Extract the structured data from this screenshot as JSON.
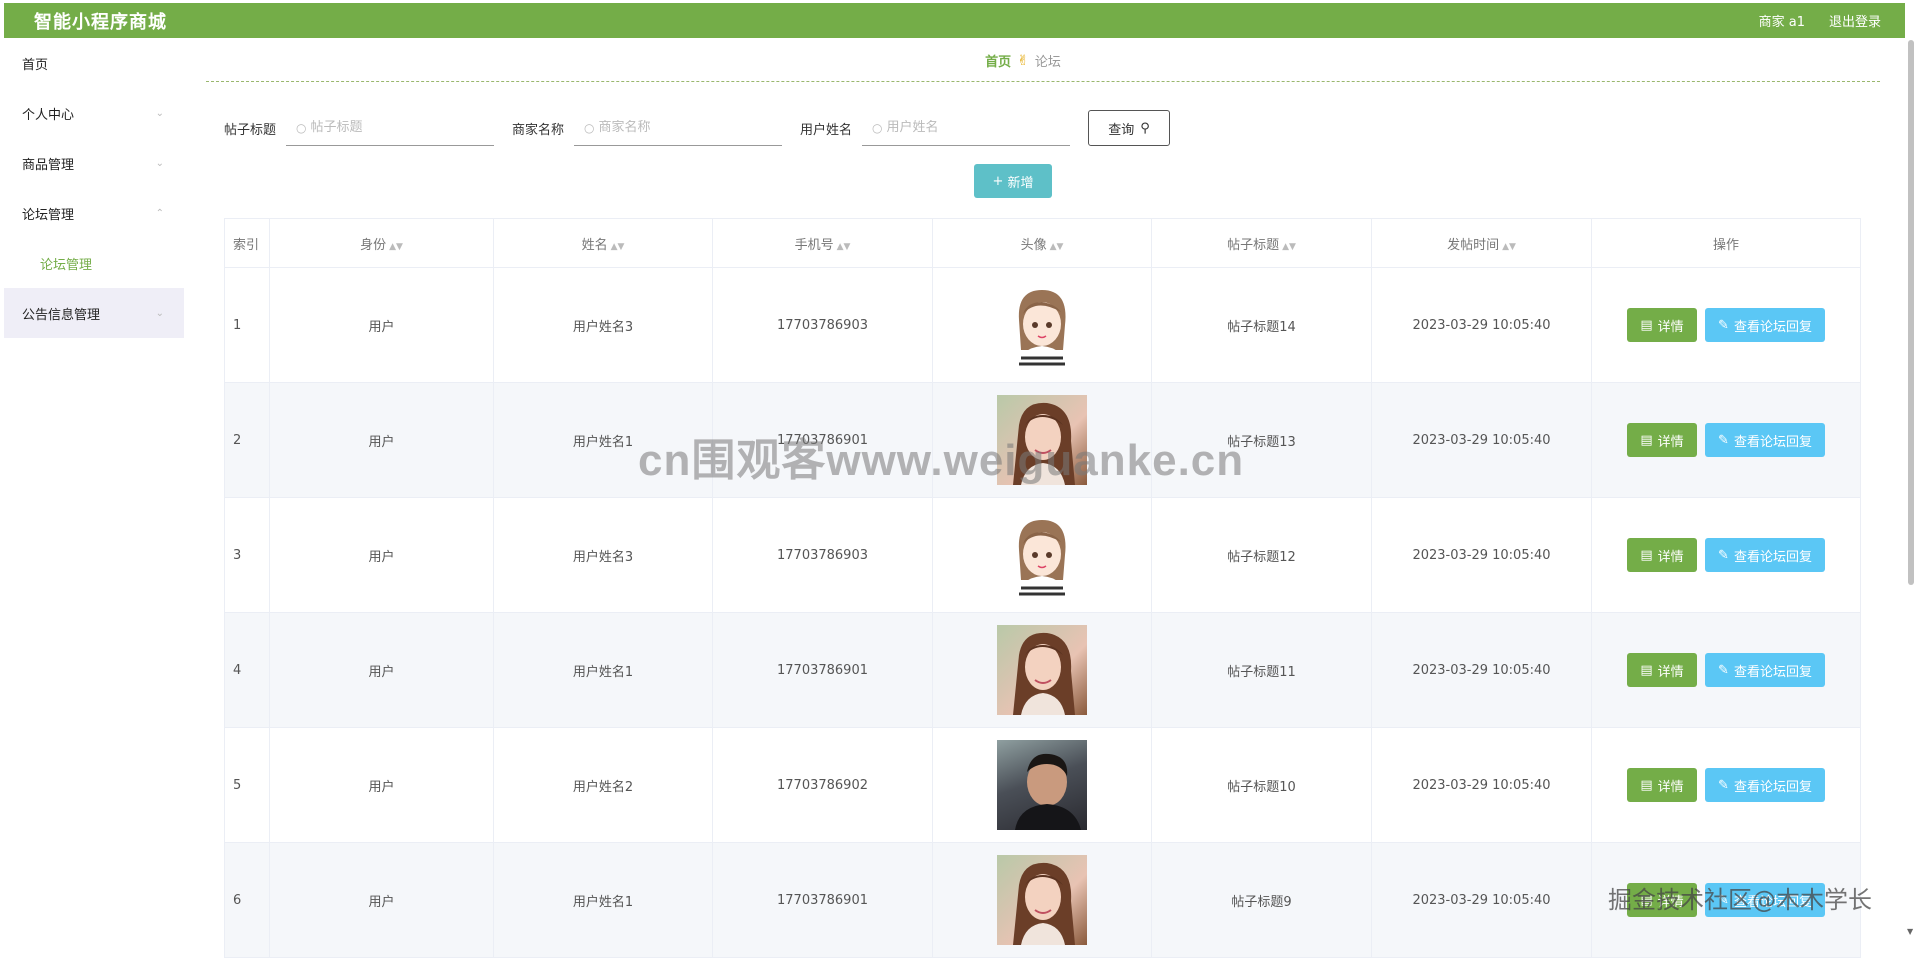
{
  "app": {
    "title": "智能小程序商城",
    "user_label": "商家 a1",
    "logout_label": "退出登录"
  },
  "sidebar": {
    "items": [
      {
        "label": "首页"
      },
      {
        "label": "个人中心"
      },
      {
        "label": "商品管理"
      },
      {
        "label": "论坛管理"
      },
      {
        "label": "论坛管理"
      },
      {
        "label": "公告信息管理"
      }
    ]
  },
  "breadcrumb": {
    "home": "首页",
    "current": "论坛"
  },
  "search": {
    "title_label": "帖子标题",
    "title_placeholder": "帖子标题",
    "merchant_label": "商家名称",
    "merchant_placeholder": "商家名称",
    "user_label": "用户姓名",
    "user_placeholder": "用户姓名",
    "query_label": "查询"
  },
  "add_label": "新增",
  "table": {
    "headers": [
      "索引",
      "身份",
      "姓名",
      "手机号",
      "头像",
      "帖子标题",
      "发帖时间",
      "操作"
    ],
    "detail_label": "详情",
    "reply_label": "查看论坛回复",
    "rows": [
      {
        "idx": "1",
        "role": "用户",
        "name": "用户姓名3",
        "phone": "17703786903",
        "avatar": "cartoon-girl",
        "title": "帖子标题14",
        "time": "2023-03-29 10:05:40"
      },
      {
        "idx": "2",
        "role": "用户",
        "name": "用户姓名1",
        "phone": "17703786901",
        "avatar": "photo-woman",
        "title": "帖子标题13",
        "time": "2023-03-29 10:05:40"
      },
      {
        "idx": "3",
        "role": "用户",
        "name": "用户姓名3",
        "phone": "17703786903",
        "avatar": "cartoon-girl",
        "title": "帖子标题12",
        "time": "2023-03-29 10:05:40"
      },
      {
        "idx": "4",
        "role": "用户",
        "name": "用户姓名1",
        "phone": "17703786901",
        "avatar": "photo-woman",
        "title": "帖子标题11",
        "time": "2023-03-29 10:05:40"
      },
      {
        "idx": "5",
        "role": "用户",
        "name": "用户姓名2",
        "phone": "17703786902",
        "avatar": "photo-man",
        "title": "帖子标题10",
        "time": "2023-03-29 10:05:40"
      },
      {
        "idx": "6",
        "role": "用户",
        "name": "用户姓名1",
        "phone": "17703786901",
        "avatar": "photo-woman",
        "title": "帖子标题9",
        "time": "2023-03-29 10:05:40"
      }
    ]
  },
  "watermarks": {
    "center": "cn围观客www.weiguanke.cn",
    "corner": "掘金技术社区@木木学长"
  },
  "colors": {
    "primary": "#74ad48",
    "teal": "#5ec0c8",
    "sky": "#5bc7f5"
  }
}
